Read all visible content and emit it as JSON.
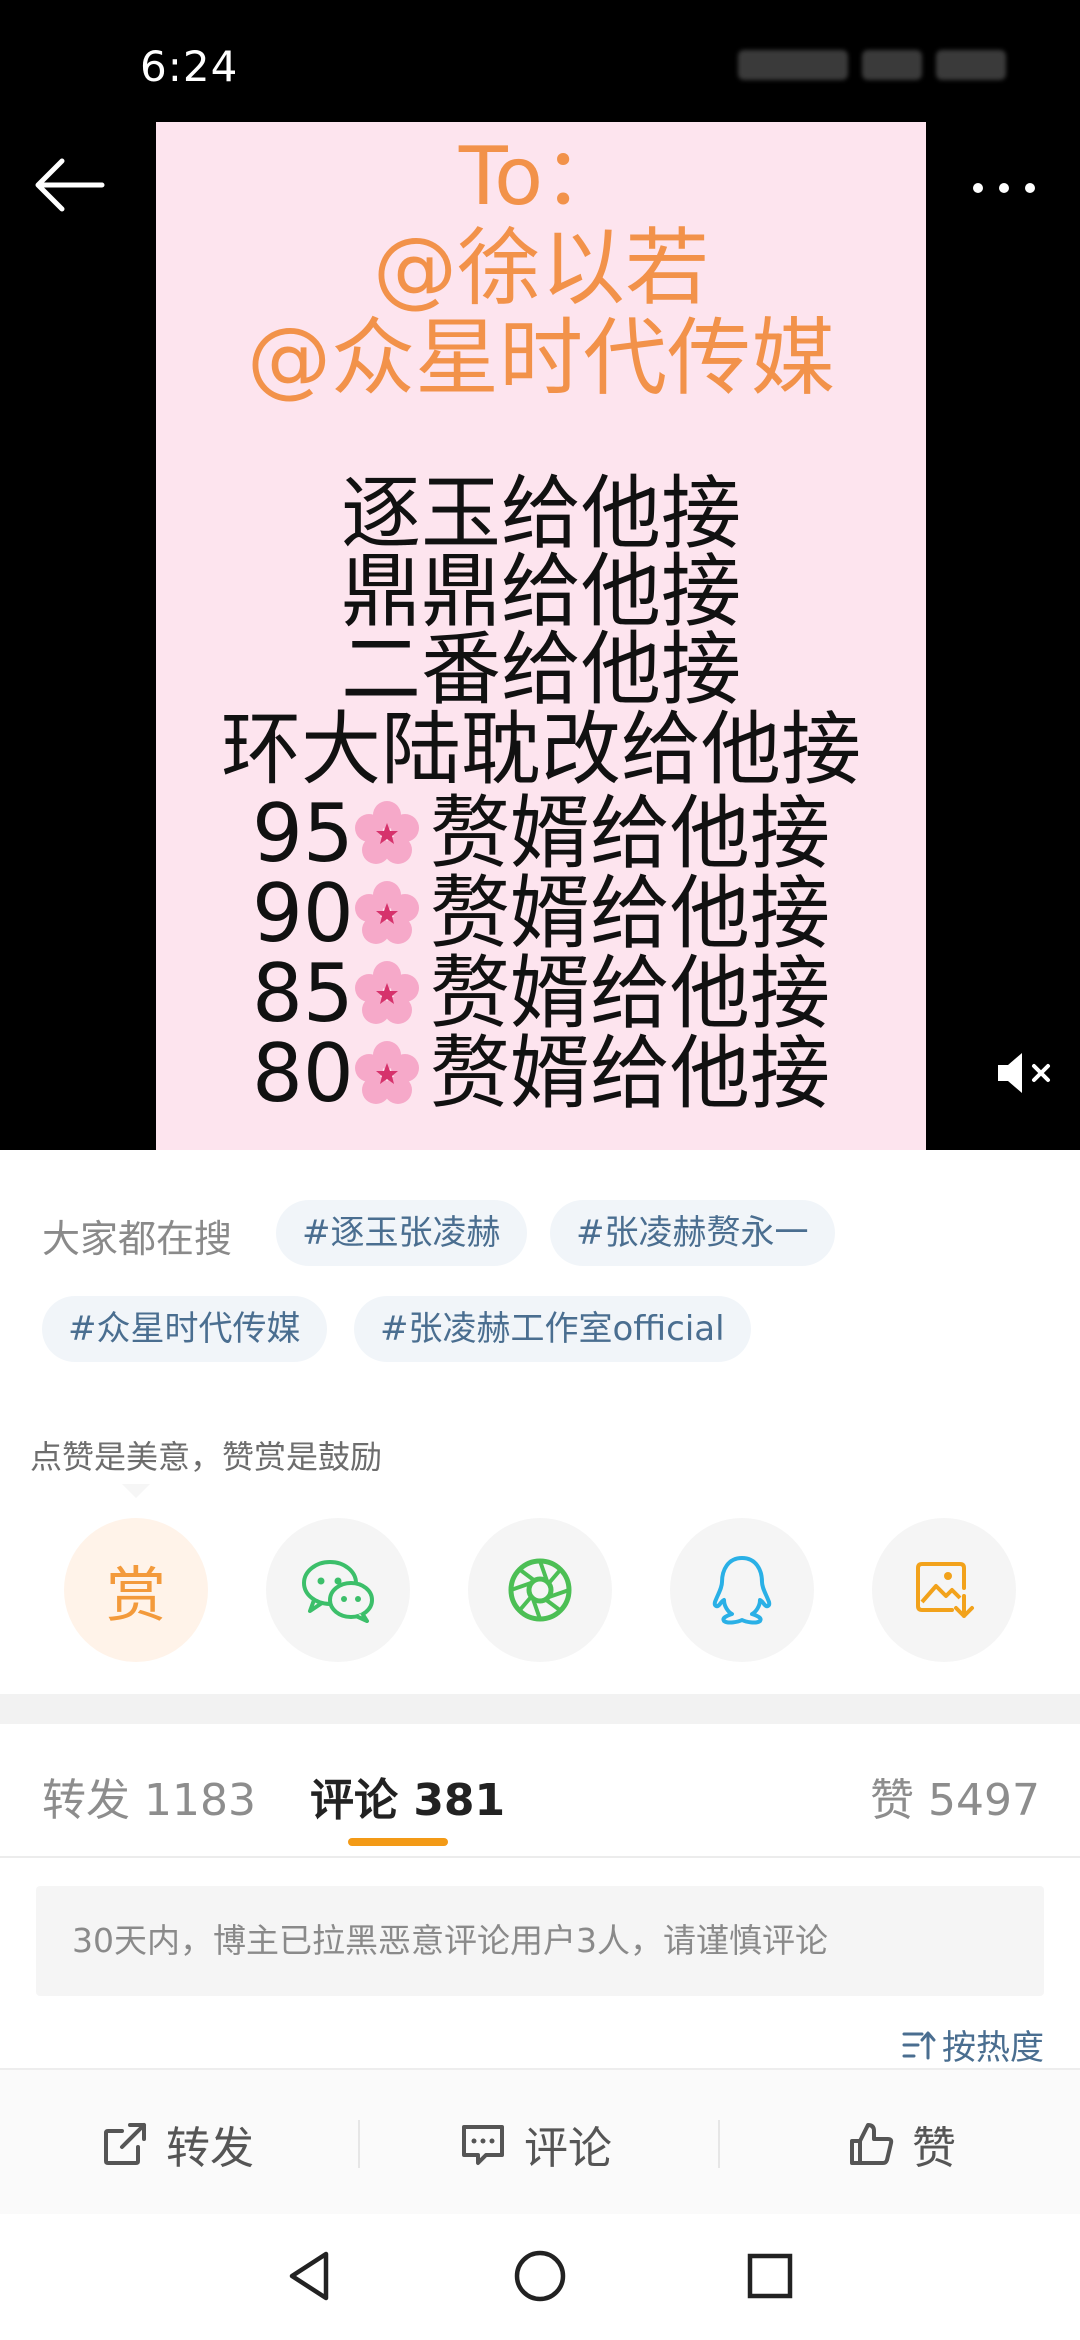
{
  "status_bar": {
    "time": "6:24"
  },
  "poster": {
    "to": "To：",
    "mentions": [
      "@徐以若",
      "@众星时代传媒"
    ],
    "lines": [
      "逐玉给他接",
      "鼎鼎给他接",
      "二番给他接",
      "环大陆耽改给他接"
    ],
    "ranked_lines": [
      {
        "num": "95",
        "text": "赘婿给他接"
      },
      {
        "num": "90",
        "text": "赘婿给他接"
      },
      {
        "num": "85",
        "text": "赘婿给他接"
      },
      {
        "num": "80",
        "text": "赘婿给他接"
      }
    ]
  },
  "hot_search": {
    "label": "大家都在搜",
    "tags": [
      "#逐玉张凌赫",
      "#张凌赫赘永一",
      "#众星时代传媒",
      "#张凌赫工作室official"
    ]
  },
  "reward": {
    "tip": "点赞是美意，赞赏是鼓励",
    "reward_label": "赏"
  },
  "share_icons": [
    "reward-icon",
    "wechat-icon",
    "moments-icon",
    "qq-icon",
    "save-image-icon"
  ],
  "tabs": {
    "repost": "转发 1183",
    "comment": "评论 381",
    "like": "赞 5497"
  },
  "notice": "30天内，博主已拉黑恶意评论用户3人，请谨慎评论",
  "sort_label": "按热度",
  "actions": {
    "repost": "转发",
    "comment": "评论",
    "like": "赞"
  },
  "colors": {
    "accent": "#f39a16",
    "link": "#4a6e90",
    "poster_bg": "#fde4ee",
    "poster_orange": "#f2924a"
  }
}
